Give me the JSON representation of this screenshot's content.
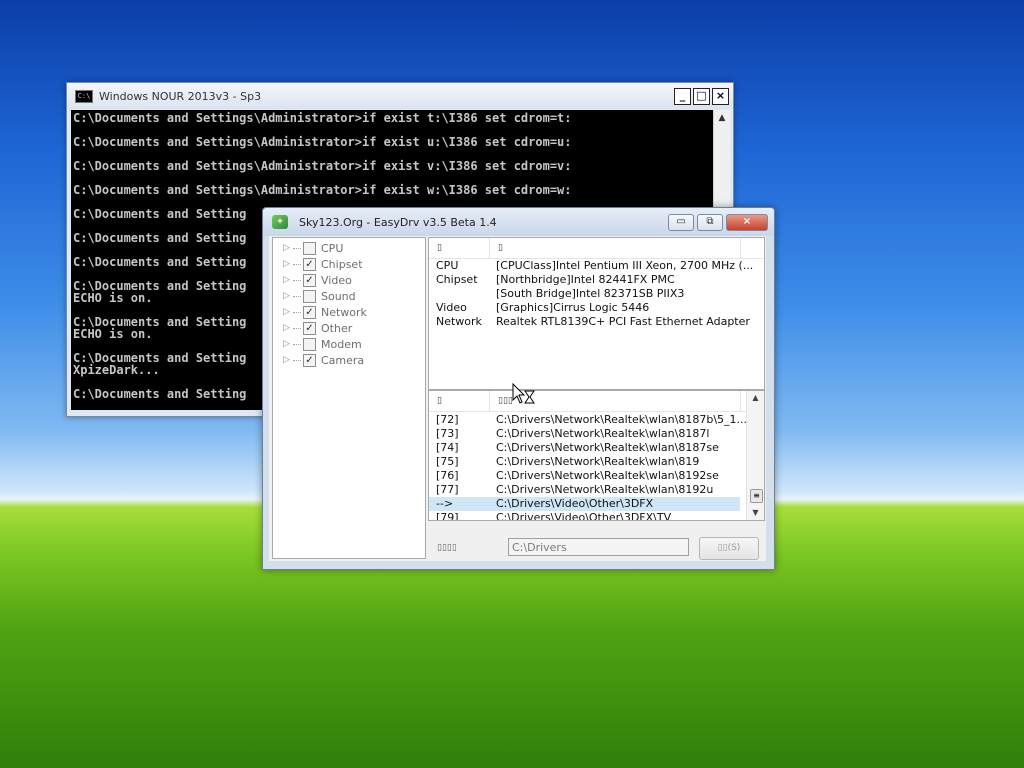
{
  "cmd": {
    "title": "Windows NOUR 2013v3 - Sp3",
    "icon_text": "C:\\",
    "controls": {
      "minimize": "_",
      "maximize": "□",
      "close": "×"
    },
    "text": "C:\\Documents and Settings\\Administrator>if exist t:\\I386 set cdrom=t:\n\nC:\\Documents and Settings\\Administrator>if exist u:\\I386 set cdrom=u:\n\nC:\\Documents and Settings\\Administrator>if exist v:\\I386 set cdrom=v:\n\nC:\\Documents and Settings\\Administrator>if exist w:\\I386 set cdrom=w:\n\nC:\\Documents and Setting\n\nC:\\Documents and Setting\n\nC:\\Documents and Setting\n\nC:\\Documents and Setting\nECHO is on.\n\nC:\\Documents and Setting\nECHO is on.\n\nC:\\Documents and Setting\nXpizeDark...\n\nC:\\Documents and Setting"
  },
  "easydrv": {
    "title": "Sky123.Org - EasyDrv v3.5 Beta 1.4",
    "controls": {
      "minimize": "▭",
      "restore": "⧉",
      "close": "×"
    },
    "tree": [
      {
        "label": "CPU",
        "checked": false
      },
      {
        "label": "Chipset",
        "checked": true
      },
      {
        "label": "Video",
        "checked": true
      },
      {
        "label": "Sound",
        "checked": false
      },
      {
        "label": "Network",
        "checked": true
      },
      {
        "label": "Other",
        "checked": true
      },
      {
        "label": "Modem",
        "checked": false
      },
      {
        "label": "Camera",
        "checked": true
      }
    ],
    "tree_expander": "▷",
    "check_mark": "✓",
    "info_headers": [
      "▯",
      "▯"
    ],
    "info_rows": [
      [
        "CPU",
        "[CPUClass]Intel Pentium III Xeon, 2700 MHz (..."
      ],
      [
        "Chipset",
        "[Northbridge]Intel 82441FX PMC"
      ],
      [
        "",
        "[South Bridge]Intel 82371SB PIIX3"
      ],
      [
        "Video",
        "[Graphics]Cirrus Logic 5446"
      ],
      [
        "Network",
        "Realtek RTL8139C+ PCI Fast Ethernet Adapter"
      ]
    ],
    "path_headers": [
      "▯",
      "▯▯▯"
    ],
    "path_rows": [
      [
        "[72]",
        "C:\\Drivers\\Network\\Realtek\\wlan\\8187b\\5_1..."
      ],
      [
        "[73]",
        "C:\\Drivers\\Network\\Realtek\\wlan\\8187l"
      ],
      [
        "[74]",
        "C:\\Drivers\\Network\\Realtek\\wlan\\8187se"
      ],
      [
        "[75]",
        "C:\\Drivers\\Network\\Realtek\\wlan\\819"
      ],
      [
        "[76]",
        "C:\\Drivers\\Network\\Realtek\\wlan\\8192se"
      ],
      [
        "[77]",
        "C:\\Drivers\\Network\\Realtek\\wlan\\8192u"
      ],
      [
        "-->",
        "C:\\Drivers\\Video\\Other\\3DFX"
      ],
      [
        "[79]",
        "C:\\Drivers\\Video\\Other\\3DFX\\TV"
      ]
    ],
    "selected_row": 6,
    "scroll": {
      "up": "▲",
      "down": "▼",
      "thumb": "≡"
    },
    "bottom_label": "▯▯▯▯",
    "path_value": "C:\\Drivers",
    "browse_label": "▯▯(S)"
  }
}
